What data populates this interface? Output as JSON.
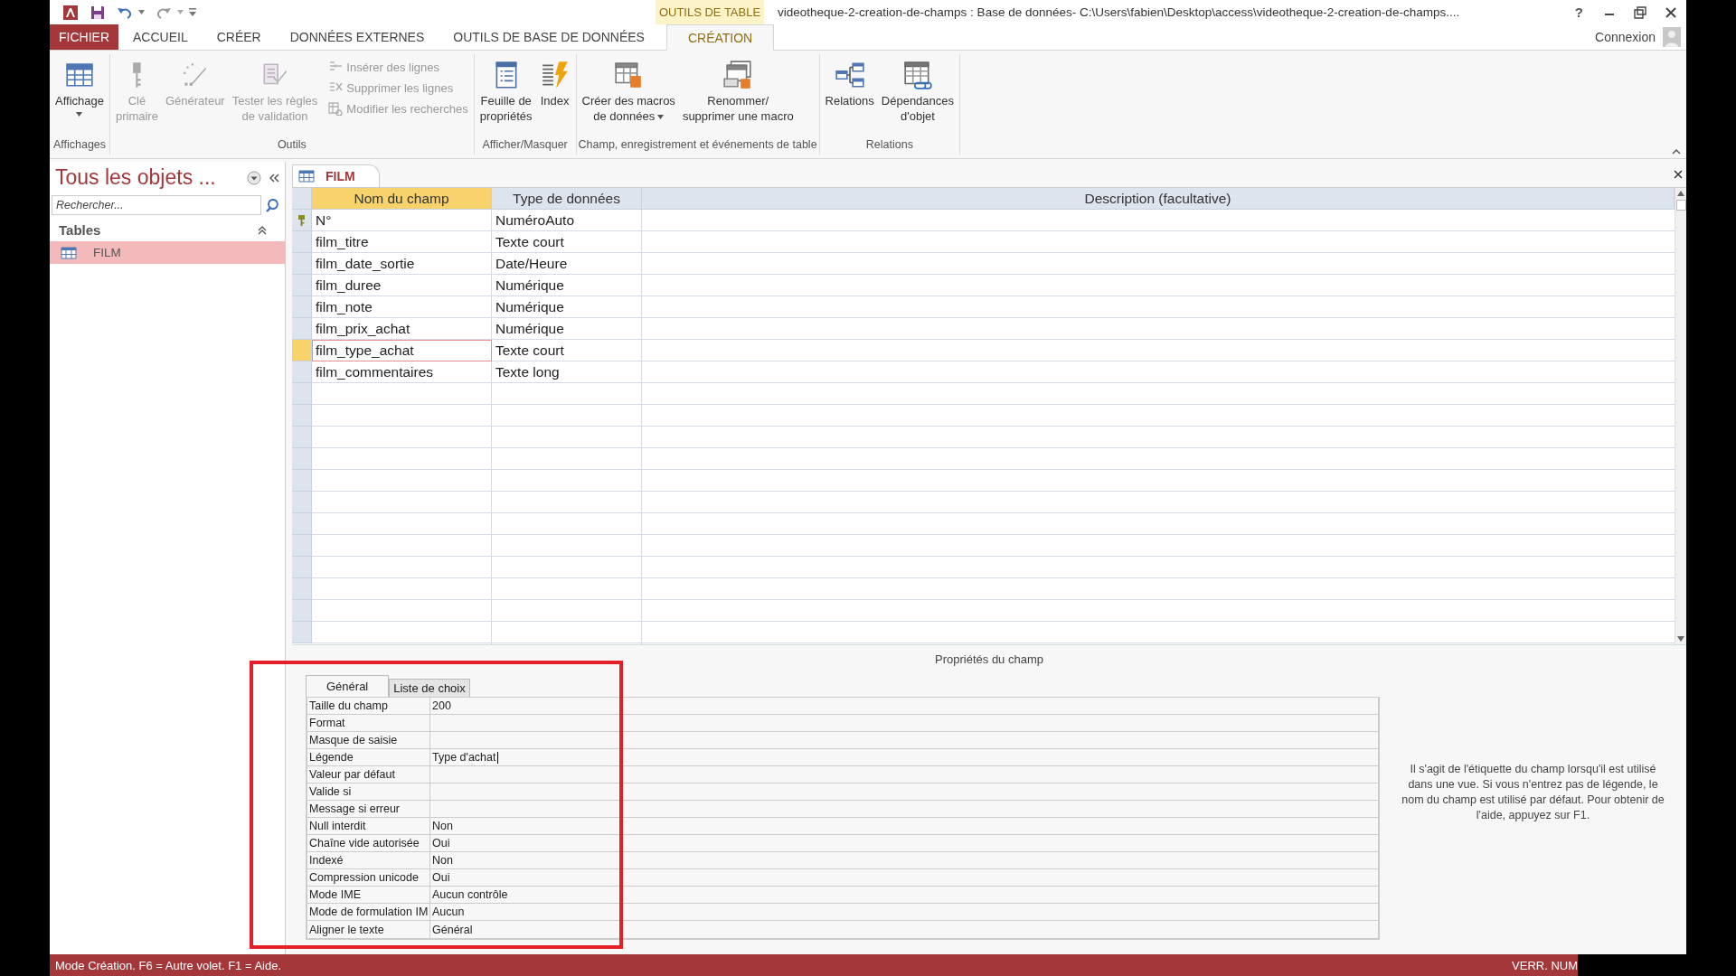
{
  "title_bar": {
    "contextual_tab": "OUTILS DE TABLE",
    "title": "videotheque-2-creation-de-champs : Base de données- C:\\Users\\fabien\\Desktop\\access\\videotheque-2-creation-de-champs....",
    "help": "?"
  },
  "ribbon_tabs": [
    {
      "label": "FICHIER",
      "kind": "file",
      "selected": false
    },
    {
      "label": "ACCUEIL",
      "kind": "tab",
      "selected": false
    },
    {
      "label": "CRÉER",
      "kind": "tab",
      "selected": false
    },
    {
      "label": "DONNÉES EXTERNES",
      "kind": "tab",
      "selected": false
    },
    {
      "label": "OUTILS DE BASE DE DONNÉES",
      "kind": "tab",
      "selected": false
    },
    {
      "label": "CRÉATION",
      "kind": "contextual",
      "selected": true
    }
  ],
  "account": "Connexion",
  "ribbon_groups": [
    {
      "label": "Affichages",
      "buttons": [
        {
          "label": "Affichage",
          "kind": "large",
          "dropdown": true,
          "disabled": false
        }
      ]
    },
    {
      "label": "Outils",
      "buttons": [
        {
          "label": "Clé\nprimaire",
          "kind": "large",
          "dropdown": false,
          "disabled": true
        },
        {
          "label": "Générateur",
          "kind": "large",
          "dropdown": false,
          "disabled": true
        },
        {
          "label": "Tester les règles\nde validation",
          "kind": "large",
          "dropdown": false,
          "disabled": true
        },
        {
          "label": "Insérer des lignes",
          "kind": "small",
          "dropdown": false,
          "disabled": true
        },
        {
          "label": "Supprimer les lignes",
          "kind": "small",
          "dropdown": false,
          "disabled": true
        },
        {
          "label": "Modifier les recherches",
          "kind": "small",
          "dropdown": false,
          "disabled": true
        }
      ]
    },
    {
      "label": "Afficher/Masquer",
      "buttons": [
        {
          "label": "Feuille de\npropriétés",
          "kind": "large",
          "dropdown": false,
          "disabled": false
        },
        {
          "label": "Index",
          "kind": "large",
          "dropdown": false,
          "disabled": false
        }
      ]
    },
    {
      "label": "Champ, enregistrement et événements de table",
      "buttons": [
        {
          "label": "Créer des macros\nde données",
          "kind": "large",
          "dropdown": true,
          "disabled": false
        },
        {
          "label": "Renommer/\nsupprimer une macro",
          "kind": "large",
          "dropdown": false,
          "disabled": false
        }
      ]
    },
    {
      "label": "Relations",
      "buttons": [
        {
          "label": "Relations",
          "kind": "large",
          "dropdown": false,
          "disabled": false
        },
        {
          "label": "Dépendances\nd'objet",
          "kind": "large",
          "dropdown": false,
          "disabled": false
        }
      ]
    }
  ],
  "nav_pane": {
    "title": "Tous les objets ...",
    "search": {
      "placeholder": "Rechercher..."
    },
    "groups": [
      {
        "label": "Tables",
        "expanded": true,
        "items": [
          {
            "label": "FILM",
            "selected": true
          }
        ]
      }
    ]
  },
  "document_tabs": [
    {
      "label": "FILM",
      "selected": true
    }
  ],
  "table": {
    "columns": [
      {
        "label": "Nom du champ",
        "selected": true
      },
      {
        "label": "Type de données",
        "selected": false
      },
      {
        "label": "Description (facultative)",
        "selected": false
      }
    ],
    "rows": [
      {
        "name": "N°",
        "type": "NuméroAuto",
        "primary_key": true,
        "selected": false
      },
      {
        "name": "film_titre",
        "type": "Texte court",
        "primary_key": false,
        "selected": false
      },
      {
        "name": "film_date_sortie",
        "type": "Date/Heure",
        "primary_key": false,
        "selected": false
      },
      {
        "name": "film_duree",
        "type": "Numérique",
        "primary_key": false,
        "selected": false
      },
      {
        "name": "film_note",
        "type": "Numérique",
        "primary_key": false,
        "selected": false
      },
      {
        "name": "film_prix_achat",
        "type": "Numérique",
        "primary_key": false,
        "selected": false
      },
      {
        "name": "film_type_achat",
        "type": "Texte court",
        "primary_key": false,
        "selected": true
      },
      {
        "name": "film_commentaires",
        "type": "Texte long",
        "primary_key": false,
        "selected": false
      }
    ]
  },
  "properties": {
    "heading": "Propriétés du champ",
    "highlighted": true,
    "tabs": [
      {
        "label": "Général",
        "selected": true
      },
      {
        "label": "Liste de choix",
        "selected": false
      }
    ],
    "rows": [
      {
        "label": "Taille du champ",
        "value": "200",
        "editing": false
      },
      {
        "label": "Format",
        "editing": false
      },
      {
        "label": "Masque de saisie",
        "editing": false
      },
      {
        "label": "Légende",
        "value": "Type d'achat",
        "editing": true
      },
      {
        "label": "Valeur par défaut",
        "editing": false
      },
      {
        "label": "Valide si",
        "editing": false
      },
      {
        "label": "Message si erreur",
        "editing": false
      },
      {
        "label": "Null interdit",
        "value": "Non",
        "editing": false
      },
      {
        "label": "Chaîne vide autorisée",
        "value": "Oui",
        "editing": false
      },
      {
        "label": "Indexé",
        "value": "Non",
        "editing": false
      },
      {
        "label": "Compression unicode",
        "value": "Oui",
        "editing": false
      },
      {
        "label": "Mode IME",
        "value": "Aucun contrôle",
        "editing": false
      },
      {
        "label": "Mode de formulation IM",
        "value": "Aucun",
        "editing": false
      },
      {
        "label": "Aligner le texte",
        "value": "Général",
        "editing": false
      }
    ],
    "help": "Il s'agit de l'étiquette du champ lorsqu'il est utilisé dans une vue. Si vous n'entrez pas de légende, le nom du champ est utilisé par défaut. Pour obtenir de l'aide, appuyez sur F1."
  },
  "status_bar": {
    "text": "Mode Création. F6 = Autre volet. F1 = Aide.",
    "indicator": "VERR. NUM"
  }
}
